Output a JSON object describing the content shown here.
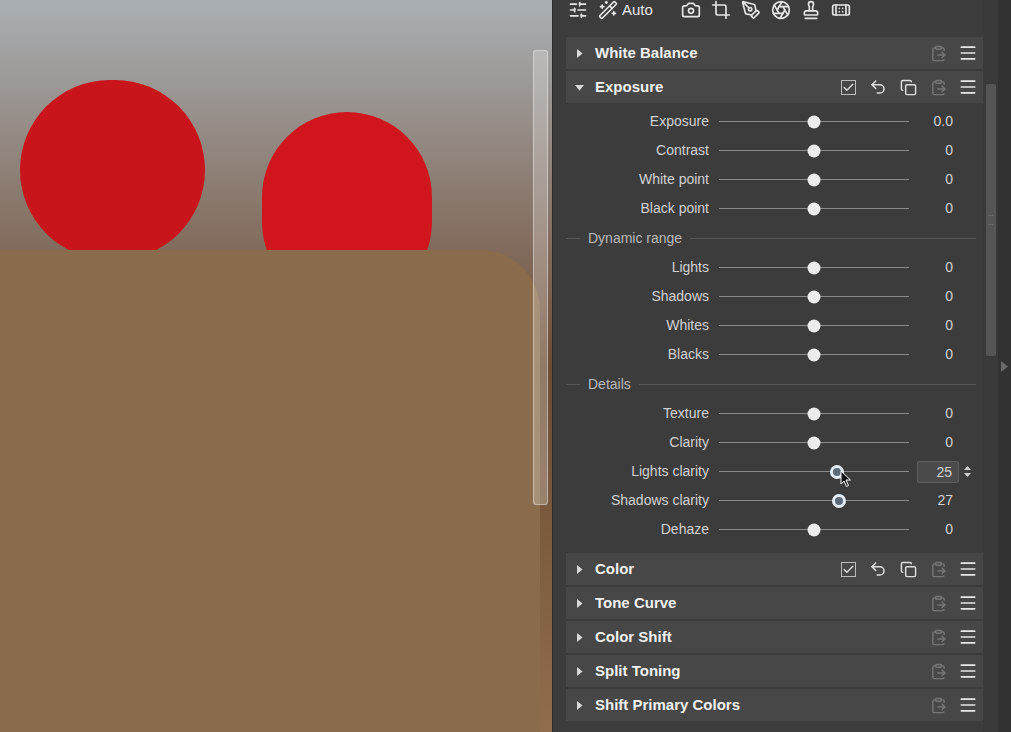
{
  "toolbar": {
    "auto_label": "Auto"
  },
  "sections": [
    {
      "title": "White Balance",
      "expanded": false,
      "controls": false,
      "checked": false,
      "rows": []
    },
    {
      "title": "Exposure",
      "expanded": true,
      "controls": true,
      "checked": true,
      "rows": [
        {
          "kind": "slider",
          "label": "Exposure",
          "value": "0.0",
          "level": 0.5,
          "modified": false,
          "focused": false
        },
        {
          "kind": "slider",
          "label": "Contrast",
          "value": "0",
          "level": 0.5,
          "modified": false,
          "focused": false
        },
        {
          "kind": "slider",
          "label": "White point",
          "value": "0",
          "level": 0.5,
          "modified": false,
          "focused": false
        },
        {
          "kind": "slider",
          "label": "Black point",
          "value": "0",
          "level": 0.5,
          "modified": false,
          "focused": false
        },
        {
          "kind": "group",
          "label": "Dynamic range"
        },
        {
          "kind": "slider",
          "label": "Lights",
          "value": "0",
          "level": 0.5,
          "modified": false,
          "focused": false
        },
        {
          "kind": "slider",
          "label": "Shadows",
          "value": "0",
          "level": 0.5,
          "modified": false,
          "focused": false
        },
        {
          "kind": "slider",
          "label": "Whites",
          "value": "0",
          "level": 0.5,
          "modified": false,
          "focused": false
        },
        {
          "kind": "slider",
          "label": "Blacks",
          "value": "0",
          "level": 0.5,
          "modified": false,
          "focused": false
        },
        {
          "kind": "group",
          "label": "Details"
        },
        {
          "kind": "slider",
          "label": "Texture",
          "value": "0",
          "level": 0.5,
          "modified": false,
          "focused": false
        },
        {
          "kind": "slider",
          "label": "Clarity",
          "value": "0",
          "level": 0.5,
          "modified": false,
          "focused": false
        },
        {
          "kind": "slider",
          "label": "Lights clarity",
          "value": "25",
          "level": 0.62,
          "modified": true,
          "focused": true
        },
        {
          "kind": "slider",
          "label": "Shadows clarity",
          "value": "27",
          "level": 0.63,
          "modified": true,
          "focused": false
        },
        {
          "kind": "slider",
          "label": "Dehaze",
          "value": "0",
          "level": 0.5,
          "modified": false,
          "focused": false
        }
      ]
    },
    {
      "title": "Color",
      "expanded": false,
      "controls": true,
      "checked": true,
      "rows": []
    },
    {
      "title": "Tone Curve",
      "expanded": false,
      "controls": false,
      "checked": false,
      "rows": []
    },
    {
      "title": "Color Shift",
      "expanded": false,
      "controls": false,
      "checked": false,
      "rows": []
    },
    {
      "title": "Split Toning",
      "expanded": false,
      "controls": false,
      "checked": false,
      "rows": []
    },
    {
      "title": "Shift Primary Colors",
      "expanded": false,
      "controls": false,
      "checked": false,
      "rows": []
    }
  ]
}
